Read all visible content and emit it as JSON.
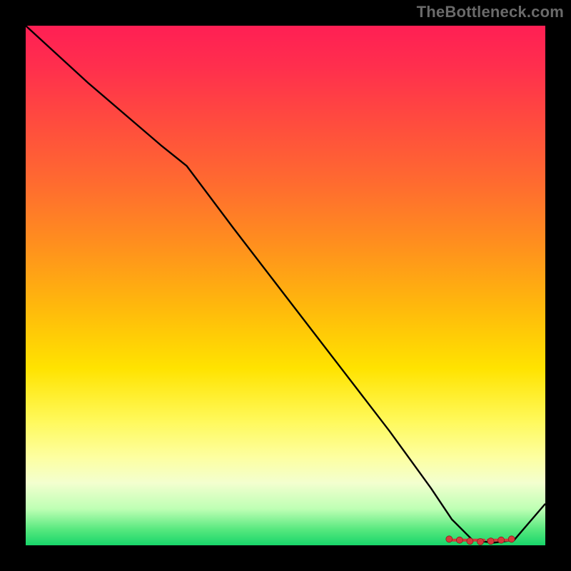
{
  "watermark": "TheBottleneck.com",
  "chart_data": {
    "type": "line",
    "title": "",
    "xlabel": "",
    "ylabel": "",
    "xlim": [
      0,
      100
    ],
    "ylim": [
      0,
      100
    ],
    "grid": false,
    "series": [
      {
        "name": "curve",
        "x": [
          0,
          12,
          26,
          31,
          40,
          50,
          60,
          70,
          78,
          82,
          86,
          90,
          94,
          100
        ],
        "y": [
          100,
          89,
          77,
          73,
          61,
          48,
          35,
          22,
          11,
          5,
          1,
          0.5,
          1,
          8
        ]
      }
    ],
    "markers": {
      "name": "bottom-cluster",
      "x": [
        81.5,
        83.5,
        85.5,
        87.5,
        89.5,
        91.5,
        93.5
      ],
      "y": [
        1.2,
        1.0,
        0.8,
        0.7,
        0.8,
        1.0,
        1.2
      ]
    },
    "dashes": {
      "y": 1.0,
      "segments": [
        [
          82.2,
          84.8
        ],
        [
          85.6,
          88.2
        ],
        [
          89.0,
          91.6
        ],
        [
          92.2,
          93.2
        ]
      ]
    }
  }
}
